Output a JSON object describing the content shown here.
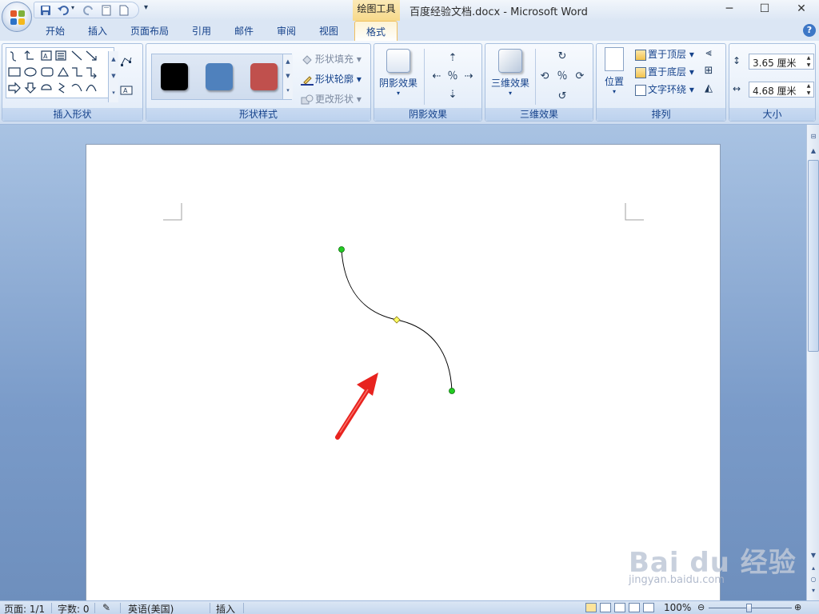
{
  "window": {
    "title": "百度经验文档.docx - Microsoft Word",
    "context_tab_group": "绘图工具"
  },
  "tabs": [
    {
      "label": "开始"
    },
    {
      "label": "插入"
    },
    {
      "label": "页面布局"
    },
    {
      "label": "引用"
    },
    {
      "label": "邮件"
    },
    {
      "label": "审阅"
    },
    {
      "label": "视图"
    },
    {
      "label": "格式",
      "active": true
    }
  ],
  "ribbon": {
    "insert_shapes": {
      "label": "插入形状"
    },
    "shape_styles": {
      "label": "形状样式",
      "swatches": [
        "#000000",
        "#4f81bd",
        "#c0504d"
      ],
      "fill": "形状填充",
      "outline": "形状轮廓",
      "change": "更改形状"
    },
    "shadow": {
      "label": "阴影效果",
      "button": "阴影效果"
    },
    "threed": {
      "label": "三维效果",
      "button": "三维效果"
    },
    "arrange": {
      "label": "排列",
      "position": "位置",
      "bring_front": "置于顶层",
      "send_back": "置于底层",
      "text_wrap": "文字环绕"
    },
    "size": {
      "label": "大小",
      "height": "3.65 厘米",
      "width": "4.68 厘米"
    }
  },
  "watermark": {
    "main": "Bai du 经验",
    "sub": "jingyan.baidu.com"
  },
  "status": {
    "page": "页面: 1/1",
    "words": "字数: 0",
    "language": "英语(美国)",
    "mode": "插入",
    "zoom": "100%",
    "zoom_level": 1.0
  },
  "colors": {
    "accent": "#15428b",
    "curve_handle": "#22cc22",
    "adjust_handle": "#ffff66",
    "arrow": "#e8231f"
  }
}
